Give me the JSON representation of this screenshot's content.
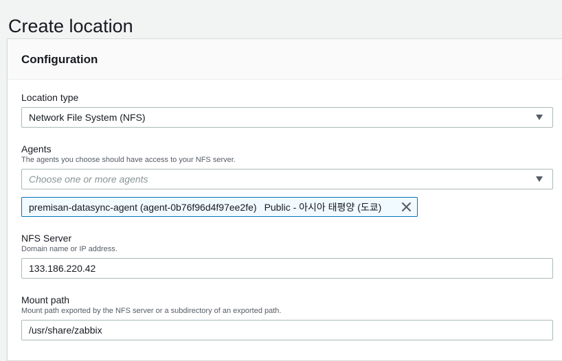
{
  "page": {
    "title": "Create location"
  },
  "configuration": {
    "header": "Configuration",
    "location_type": {
      "label": "Location type",
      "selected": "Network File System (NFS)"
    },
    "agents": {
      "label": "Agents",
      "description": "The agents you choose should have access to your NFS server.",
      "placeholder": "Choose one or more agents",
      "selected_tokens": [
        {
          "label": "premisan-datasync-agent (agent-0b76f96d4f97ee2fe)",
          "tag": "Public - 아시아 태평양 (도쿄)"
        }
      ]
    },
    "nfs_server": {
      "label": "NFS Server",
      "description": "Domain name or IP address.",
      "value": "133.186.220.42"
    },
    "mount_path": {
      "label": "Mount path",
      "description": "Mount path exported by the NFS server or a subdirectory of an exported path.",
      "value": "/usr/share/zabbix"
    }
  },
  "icons": {
    "dropdown": "caret-down-icon",
    "remove_token": "close-icon"
  },
  "colors": {
    "page_background": "#f2f3f3",
    "token_border": "#0073bb",
    "token_background": "#f1faff",
    "input_border": "#aab7b8"
  }
}
